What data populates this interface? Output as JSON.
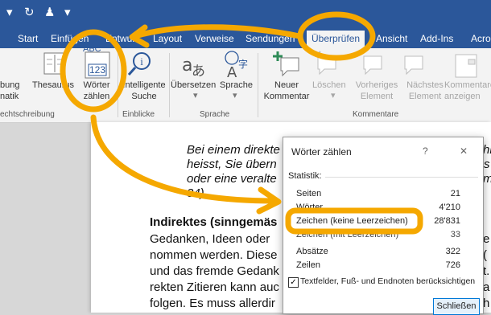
{
  "qat": {
    "undo": "↶",
    "redo": "↻",
    "customize": "▾"
  },
  "tabs": [
    "Start",
    "Einfügen",
    "Entwurf",
    "Layout",
    "Verweise",
    "Sendungen",
    "Überprüfen",
    "Ansicht",
    "Add-Ins",
    "Acro"
  ],
  "active_tab": "Überprüfen",
  "ribbon": {
    "buttons": {
      "spelling": "bung\nnatik",
      "thesaurus": "Thesaurus",
      "wordcount": "Wörter\nzählen",
      "wordcount_icon_top": "ABC",
      "wordcount_icon_bottom": "123",
      "smartlookup": "Intelligente\nSuche",
      "translate": "Übersetzen",
      "language": "Sprache",
      "newcomment": "Neuer\nKommentar",
      "delete": "Löschen",
      "previous": "Vorheriges\nElement",
      "next": "Nächstes\nElement",
      "showcomments": "Kommentare\nanzeigen"
    },
    "groups": {
      "proofing": "echtschreibung",
      "insights": "Einblicke",
      "language": "Sprache",
      "comments": "Kommentare"
    }
  },
  "document": {
    "quote_lines": [
      "Bei einem direkte",
      "heisst, Sie übern",
      "oder eine veralte",
      "34)."
    ],
    "heading": "Indirektes (sinngemäs",
    "body_lines": [
      "Gedanken, Ideen oder",
      "nommen werden. Diese",
      "und das fremde Gedank",
      "rekten Zitieren kann auc",
      "folgen. Es muss allerdir"
    ],
    "right_fragments": [
      "hi",
      "s",
      "m",
      "e",
      "(",
      "t.",
      "a",
      "h"
    ]
  },
  "dialog": {
    "title": "Wörter zählen",
    "help": "?",
    "close_x": "✕",
    "section": "Statistik:",
    "rows": [
      {
        "label": "Seiten",
        "value": "21"
      },
      {
        "label": "Wörter",
        "value": "4'210"
      },
      {
        "label": "Zeichen (keine Leerzeichen)",
        "value": "28'831"
      },
      {
        "label": "Zeichen (mit Leerzeichen)",
        "value": "33"
      },
      {
        "label": "Absätze",
        "value": "322"
      },
      {
        "label": "Zeilen",
        "value": "726"
      }
    ],
    "checkbox_label": "Textfelder, Fuß- und Endnoten berücksichtigen",
    "checkbox_checked": true,
    "close_button": "Schließen"
  },
  "colors": {
    "accent": "#2b579a",
    "annotation": "#f5a800"
  }
}
